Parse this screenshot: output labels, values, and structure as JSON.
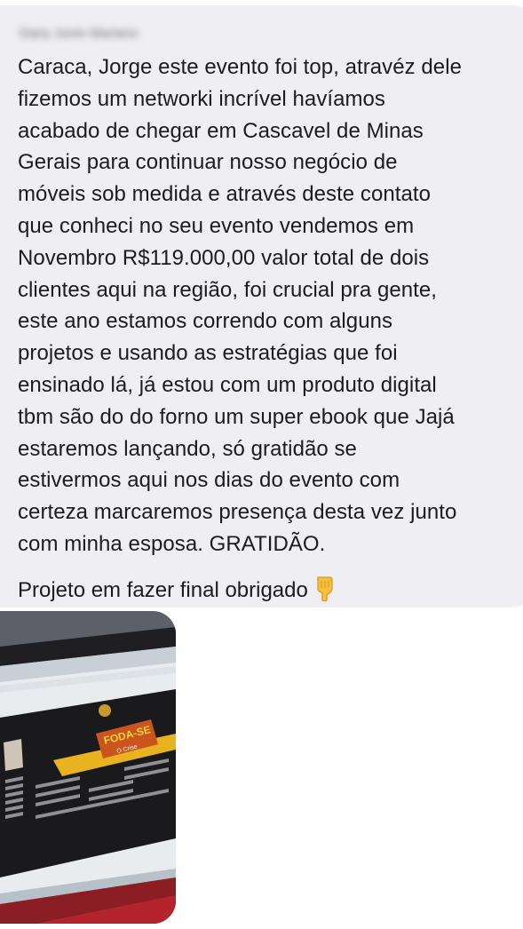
{
  "message": {
    "sender": "Dany Junio Mariano",
    "lines": [
      "Caraca, Jorge este evento foi top, atravéz dele",
      "fizemos um networki incrível havíamos",
      "acabado de chegar em Cascavel de Minas",
      "Gerais para continuar nosso negócio de",
      "móveis sob medida e através deste contato",
      "que conheci no seu evento vendemos em",
      "Novembro R$119.000,00 valor total de dois",
      "clientes aqui na região, foi crucial pra gente,",
      "este ano estamos correndo com alguns",
      "projetos e usando as estratégias que foi",
      "ensinado lá, já estou com um produto digital",
      "tbm são do do forno um super ebook que Jajá",
      "estaremos lançando, só gratidão se",
      "estivermos aqui nos dias do evento com",
      "certeza marcaremos presença desta vez junto",
      "com minha esposa. GRATIDÃO."
    ],
    "closing": "Projeto em fazer final obrigado",
    "closing_emoji": "pointing-down-hand-icon"
  },
  "attachment": {
    "type": "photo",
    "logo_text": "FODA-SE",
    "logo_subtext": "O Crise"
  }
}
